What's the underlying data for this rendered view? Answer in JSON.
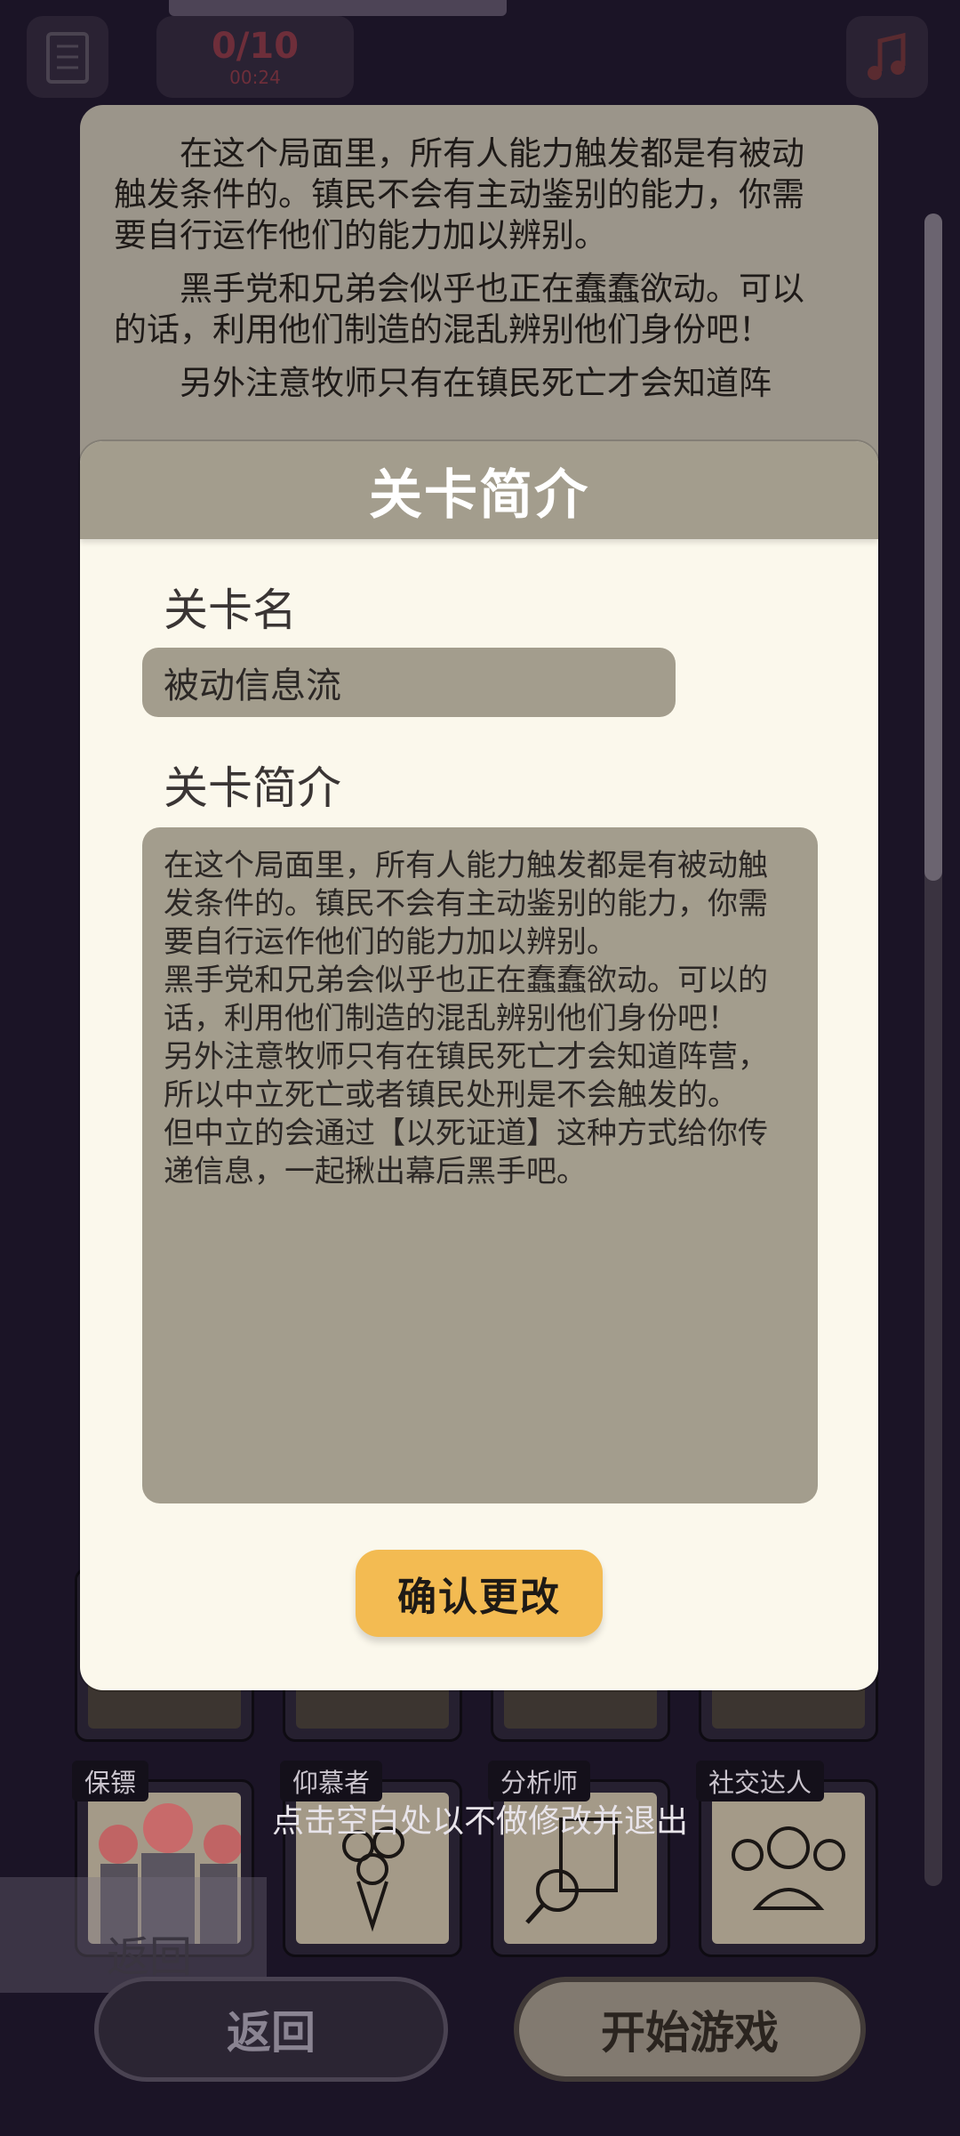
{
  "top_bar": {
    "counter_value": "0/10",
    "counter_time": "00:24"
  },
  "characters": [
    {
      "tag": "保镖"
    },
    {
      "tag": "仰慕者"
    },
    {
      "tag": "分析师"
    },
    {
      "tag": "社交达人"
    }
  ],
  "info_panel": {
    "paragraph_1": "在这个局面里，所有人能力触发都是有被动触发条件的。镇民不会有主动鉴别的能力，你需要自行运作他们的能力加以辨别。",
    "paragraph_2": "黑手党和兄弟会似乎也正在蠢蠢欲动。可以的话，利用他们制造的混乱辨别他们身份吧！",
    "paragraph_3": "另外注意牧师只有在镇民死亡才会知道阵"
  },
  "modal": {
    "title": "关卡简介",
    "name_label": "关卡名",
    "name_value": "被动信息流",
    "desc_label": "关卡简介",
    "desc_value": "在这个局面里，所有人能力触发都是有被动触发条件的。镇民不会有主动鉴别的能力，你需要自行运作他们的能力加以辨别。\n黑手党和兄弟会似乎也正在蠢蠢欲动。可以的话，利用他们制造的混乱辨别他们身份吧！\n另外注意牧师只有在镇民死亡才会知道阵营，所以中立死亡或者镇民处刑是不会触发的。\n但中立的会通过【以死证道】这种方式给你传递信息，一起揪出幕后黑手吧。",
    "confirm_label": "确认更改"
  },
  "hint": "点击空白处以不做修改并退出",
  "bottom": {
    "back_ghost_label": "返回",
    "back_label": "返回",
    "start_label": "开始游戏"
  }
}
